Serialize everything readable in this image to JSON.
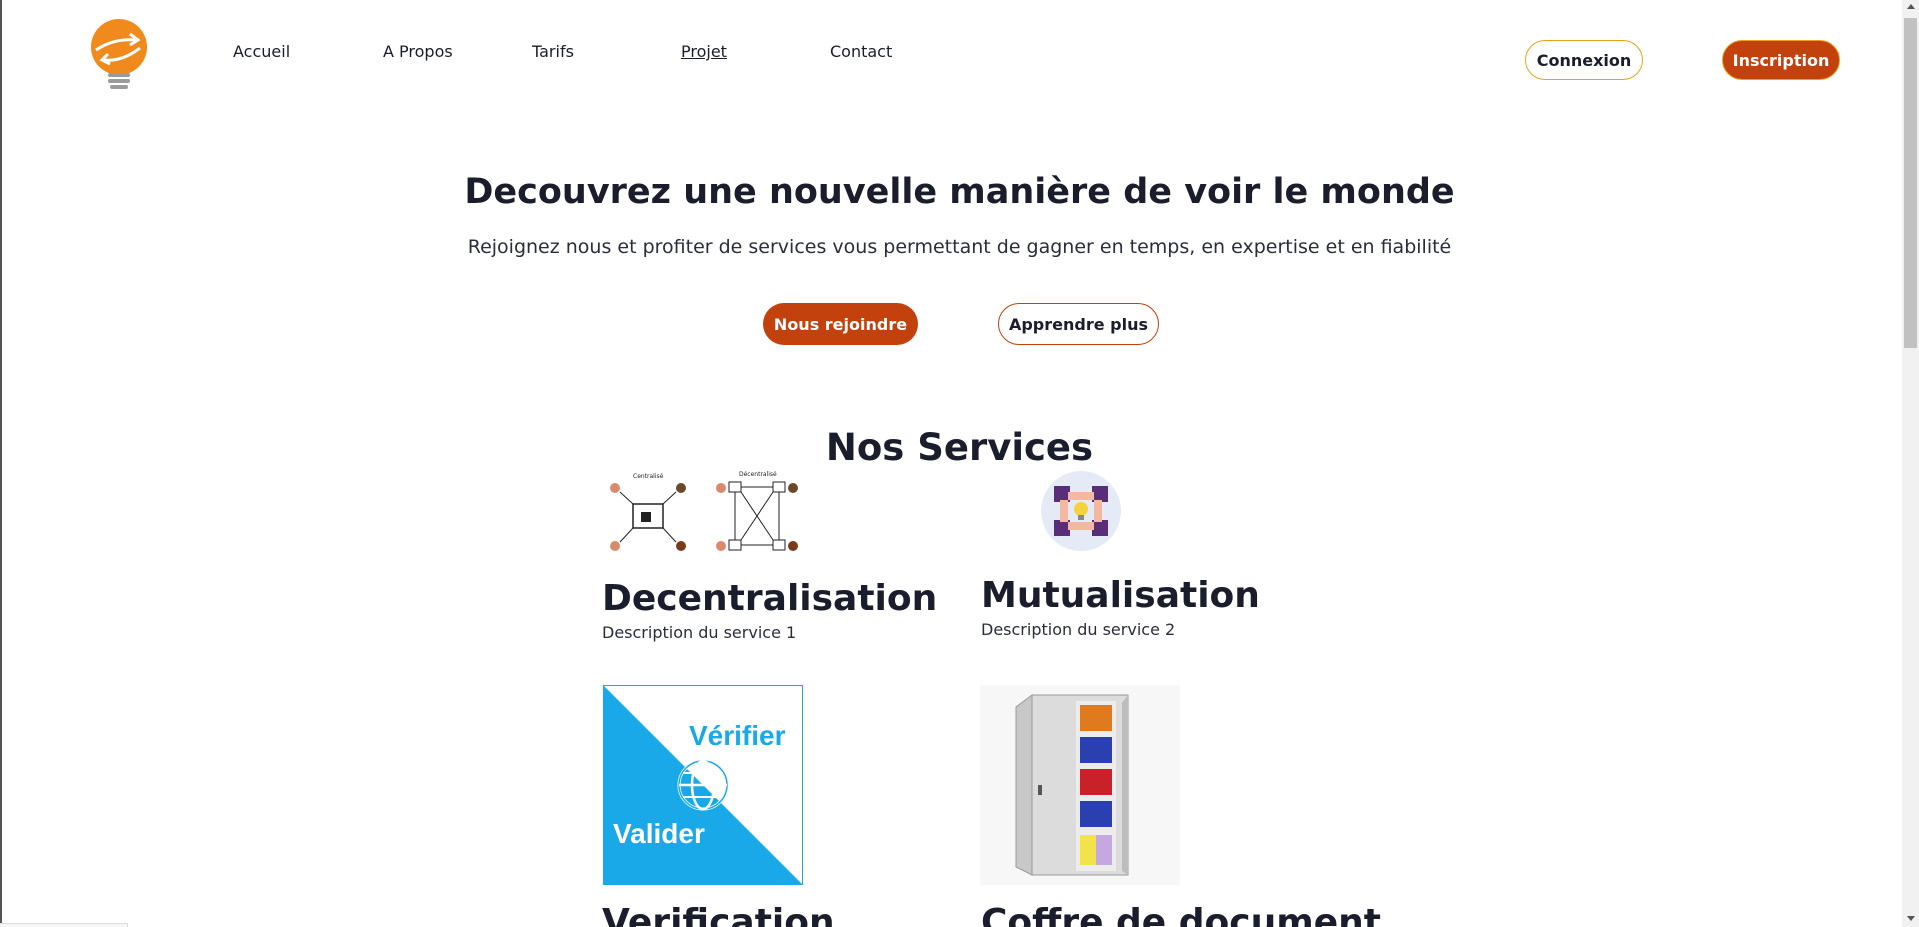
{
  "nav": {
    "items": [
      {
        "label": "Accueil",
        "active": false
      },
      {
        "label": "A Propos",
        "active": false
      },
      {
        "label": "Tarifs",
        "active": false
      },
      {
        "label": "Projet",
        "active": true
      },
      {
        "label": "Contact",
        "active": false
      }
    ],
    "login_label": "Connexion",
    "signup_label": "Inscription"
  },
  "hero": {
    "title": "Decouvrez une nouvelle manière de voir le monde",
    "subtitle": "Rejoignez nous et profiter de services vous permettant de gagner en temps, en expertise et en fiabilité",
    "primary_button": "Nous rejoindre",
    "secondary_button": "Apprendre plus"
  },
  "services": {
    "title": "Nos Services",
    "items": [
      {
        "name": "Decentralisation",
        "description": "Description du service 1",
        "image_labels": [
          "Centralisé",
          "Décentralisé"
        ]
      },
      {
        "name": "Mutualisation",
        "description": "Description du service 2"
      },
      {
        "name": "Verification",
        "image_labels": [
          "Vérifier",
          "Valider"
        ]
      },
      {
        "name": "Coffre de document"
      }
    ]
  },
  "colors": {
    "accent": "#c2410c",
    "accent_border": "#e8a317",
    "text": "#1a1d2b",
    "verify_blue": "#1aa9e8",
    "logo_orange": "#f08a1c"
  },
  "icons": [
    "lightbulb-logo-icon",
    "decentralisation-diagram-icon",
    "hands-lightbulb-icon",
    "globe-icon",
    "document-safe-icon"
  ]
}
